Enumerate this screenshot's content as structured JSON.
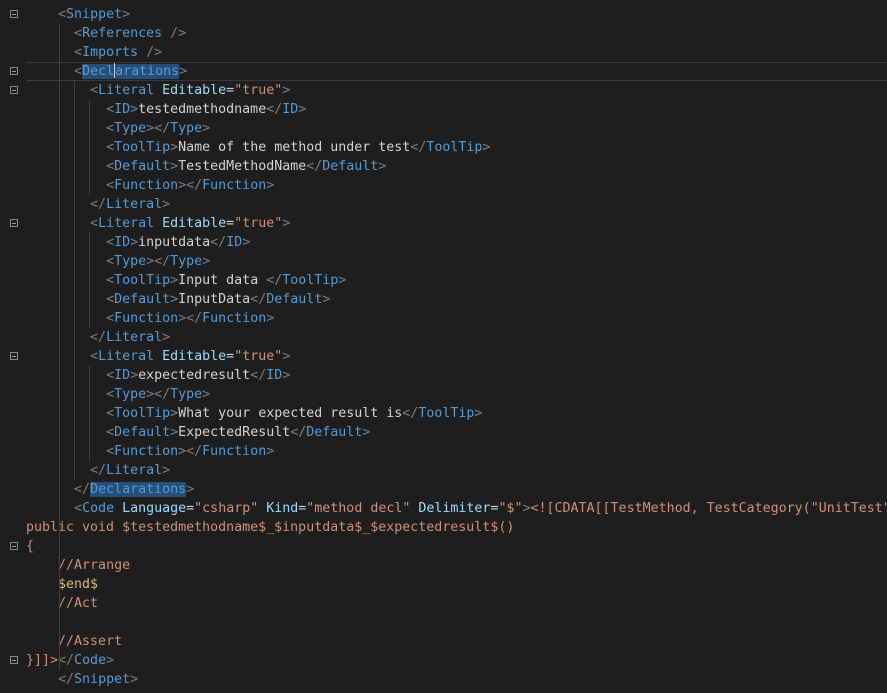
{
  "editor": {
    "lines": [
      {
        "fold": true,
        "indent": 4,
        "tokens": [
          [
            "punct",
            "<"
          ],
          [
            "tag",
            "Snippet"
          ],
          [
            "punct",
            ">"
          ]
        ]
      },
      {
        "fold": false,
        "indent": 6,
        "tokens": [
          [
            "punct",
            "<"
          ],
          [
            "tag",
            "References"
          ],
          [
            "punct",
            " />"
          ]
        ]
      },
      {
        "fold": false,
        "indent": 6,
        "tokens": [
          [
            "punct",
            "<"
          ],
          [
            "tag",
            "Imports"
          ],
          [
            "punct",
            " />"
          ]
        ]
      },
      {
        "fold": true,
        "indent": 6,
        "current": true,
        "tokens": [
          [
            "punct",
            "<"
          ],
          [
            "tag-hl",
            "Decl"
          ],
          [
            "caret",
            ""
          ],
          [
            "tag-hl",
            "arations"
          ],
          [
            "punct",
            ">"
          ]
        ]
      },
      {
        "fold": true,
        "indent": 8,
        "tokens": [
          [
            "punct",
            "<"
          ],
          [
            "tag",
            "Literal"
          ],
          [
            "text",
            " "
          ],
          [
            "attr",
            "Editable"
          ],
          [
            "text",
            "="
          ],
          [
            "str",
            "\"true\""
          ],
          [
            "punct",
            ">"
          ]
        ]
      },
      {
        "fold": false,
        "indent": 10,
        "tokens": [
          [
            "punct",
            "<"
          ],
          [
            "tag",
            "ID"
          ],
          [
            "punct",
            ">"
          ],
          [
            "text",
            "testedmethodname"
          ],
          [
            "punct",
            "</"
          ],
          [
            "tag",
            "ID"
          ],
          [
            "punct",
            ">"
          ]
        ]
      },
      {
        "fold": false,
        "indent": 10,
        "tokens": [
          [
            "punct",
            "<"
          ],
          [
            "tag",
            "Type"
          ],
          [
            "punct",
            "></"
          ],
          [
            "tag",
            "Type"
          ],
          [
            "punct",
            ">"
          ]
        ]
      },
      {
        "fold": false,
        "indent": 10,
        "tokens": [
          [
            "punct",
            "<"
          ],
          [
            "tag",
            "ToolTip"
          ],
          [
            "punct",
            ">"
          ],
          [
            "text",
            "Name of the method under test"
          ],
          [
            "punct",
            "</"
          ],
          [
            "tag",
            "ToolTip"
          ],
          [
            "punct",
            ">"
          ]
        ]
      },
      {
        "fold": false,
        "indent": 10,
        "tokens": [
          [
            "punct",
            "<"
          ],
          [
            "tag",
            "Default"
          ],
          [
            "punct",
            ">"
          ],
          [
            "text",
            "TestedMethodName"
          ],
          [
            "punct",
            "</"
          ],
          [
            "tag",
            "Default"
          ],
          [
            "punct",
            ">"
          ]
        ]
      },
      {
        "fold": false,
        "indent": 10,
        "tokens": [
          [
            "punct",
            "<"
          ],
          [
            "tag",
            "Function"
          ],
          [
            "punct",
            "></"
          ],
          [
            "tag",
            "Function"
          ],
          [
            "punct",
            ">"
          ]
        ]
      },
      {
        "fold": false,
        "indent": 8,
        "tokens": [
          [
            "punct",
            "</"
          ],
          [
            "tag",
            "Literal"
          ],
          [
            "punct",
            ">"
          ]
        ]
      },
      {
        "fold": true,
        "indent": 8,
        "tokens": [
          [
            "punct",
            "<"
          ],
          [
            "tag",
            "Literal"
          ],
          [
            "text",
            " "
          ],
          [
            "attr",
            "Editable"
          ],
          [
            "text",
            "="
          ],
          [
            "str",
            "\"true\""
          ],
          [
            "punct",
            ">"
          ]
        ]
      },
      {
        "fold": false,
        "indent": 10,
        "tokens": [
          [
            "punct",
            "<"
          ],
          [
            "tag",
            "ID"
          ],
          [
            "punct",
            ">"
          ],
          [
            "text",
            "inputdata"
          ],
          [
            "punct",
            "</"
          ],
          [
            "tag",
            "ID"
          ],
          [
            "punct",
            ">"
          ]
        ]
      },
      {
        "fold": false,
        "indent": 10,
        "tokens": [
          [
            "punct",
            "<"
          ],
          [
            "tag",
            "Type"
          ],
          [
            "punct",
            "></"
          ],
          [
            "tag",
            "Type"
          ],
          [
            "punct",
            ">"
          ]
        ]
      },
      {
        "fold": false,
        "indent": 10,
        "tokens": [
          [
            "punct",
            "<"
          ],
          [
            "tag",
            "ToolTip"
          ],
          [
            "punct",
            ">"
          ],
          [
            "text",
            "Input data "
          ],
          [
            "punct",
            "</"
          ],
          [
            "tag",
            "ToolTip"
          ],
          [
            "punct",
            ">"
          ]
        ]
      },
      {
        "fold": false,
        "indent": 10,
        "tokens": [
          [
            "punct",
            "<"
          ],
          [
            "tag",
            "Default"
          ],
          [
            "punct",
            ">"
          ],
          [
            "text",
            "InputData"
          ],
          [
            "punct",
            "</"
          ],
          [
            "tag",
            "Default"
          ],
          [
            "punct",
            ">"
          ]
        ]
      },
      {
        "fold": false,
        "indent": 10,
        "tokens": [
          [
            "punct",
            "<"
          ],
          [
            "tag",
            "Function"
          ],
          [
            "punct",
            "></"
          ],
          [
            "tag",
            "Function"
          ],
          [
            "punct",
            ">"
          ]
        ]
      },
      {
        "fold": false,
        "indent": 8,
        "tokens": [
          [
            "punct",
            "</"
          ],
          [
            "tag",
            "Literal"
          ],
          [
            "punct",
            ">"
          ]
        ]
      },
      {
        "fold": true,
        "indent": 8,
        "tokens": [
          [
            "punct",
            "<"
          ],
          [
            "tag",
            "Literal"
          ],
          [
            "text",
            " "
          ],
          [
            "attr",
            "Editable"
          ],
          [
            "text",
            "="
          ],
          [
            "str",
            "\"true\""
          ],
          [
            "punct",
            ">"
          ]
        ]
      },
      {
        "fold": false,
        "indent": 10,
        "tokens": [
          [
            "punct",
            "<"
          ],
          [
            "tag",
            "ID"
          ],
          [
            "punct",
            ">"
          ],
          [
            "text",
            "expectedresult"
          ],
          [
            "punct",
            "</"
          ],
          [
            "tag",
            "ID"
          ],
          [
            "punct",
            ">"
          ]
        ]
      },
      {
        "fold": false,
        "indent": 10,
        "tokens": [
          [
            "punct",
            "<"
          ],
          [
            "tag",
            "Type"
          ],
          [
            "punct",
            "></"
          ],
          [
            "tag",
            "Type"
          ],
          [
            "punct",
            ">"
          ]
        ]
      },
      {
        "fold": false,
        "indent": 10,
        "tokens": [
          [
            "punct",
            "<"
          ],
          [
            "tag",
            "ToolTip"
          ],
          [
            "punct",
            ">"
          ],
          [
            "text",
            "What your expected result is"
          ],
          [
            "punct",
            "</"
          ],
          [
            "tag",
            "ToolTip"
          ],
          [
            "punct",
            ">"
          ]
        ]
      },
      {
        "fold": false,
        "indent": 10,
        "tokens": [
          [
            "punct",
            "<"
          ],
          [
            "tag",
            "Default"
          ],
          [
            "punct",
            ">"
          ],
          [
            "text",
            "ExpectedResult"
          ],
          [
            "punct",
            "</"
          ],
          [
            "tag",
            "Default"
          ],
          [
            "punct",
            ">"
          ]
        ]
      },
      {
        "fold": false,
        "indent": 10,
        "tokens": [
          [
            "punct",
            "<"
          ],
          [
            "tag",
            "Function"
          ],
          [
            "punct",
            "></"
          ],
          [
            "tag",
            "Function"
          ],
          [
            "punct",
            ">"
          ]
        ]
      },
      {
        "fold": false,
        "indent": 8,
        "tokens": [
          [
            "punct",
            "</"
          ],
          [
            "tag",
            "Literal"
          ],
          [
            "punct",
            ">"
          ]
        ]
      },
      {
        "fold": false,
        "indent": 6,
        "tokens": [
          [
            "punct",
            "</"
          ],
          [
            "tag-hl",
            "Declarations"
          ],
          [
            "punct",
            ">"
          ]
        ]
      },
      {
        "fold": false,
        "indent": 6,
        "tokens": [
          [
            "punct",
            "<"
          ],
          [
            "tag",
            "Code"
          ],
          [
            "text",
            " "
          ],
          [
            "attr",
            "Language"
          ],
          [
            "text",
            "="
          ],
          [
            "str",
            "\"csharp\""
          ],
          [
            "text",
            " "
          ],
          [
            "attr",
            "Kind"
          ],
          [
            "text",
            "="
          ],
          [
            "str",
            "\"method decl\""
          ],
          [
            "text",
            " "
          ],
          [
            "attr",
            "Delimiter"
          ],
          [
            "text",
            "="
          ],
          [
            "str",
            "\"$\""
          ],
          [
            "punct",
            ">"
          ],
          [
            "cdata",
            "<![CDATA[[TestMethod, TestCategory(\"UnitTest\")]"
          ]
        ]
      },
      {
        "fold": false,
        "indent": 0,
        "tokens": [
          [
            "cdata",
            "public void $testedmethodname$_$inputdata$_$expectedresult$()"
          ]
        ]
      },
      {
        "fold": true,
        "indent": 0,
        "tokens": [
          [
            "cdata",
            "{"
          ]
        ]
      },
      {
        "fold": false,
        "indent": 4,
        "tokens": [
          [
            "cdata",
            "//Arrange"
          ]
        ]
      },
      {
        "fold": false,
        "indent": 4,
        "tokens": [
          [
            "comment",
            "$end$"
          ]
        ]
      },
      {
        "fold": false,
        "indent": 4,
        "tokens": [
          [
            "cdata",
            "//Act"
          ]
        ]
      },
      {
        "fold": false,
        "indent": 0,
        "tokens": []
      },
      {
        "fold": false,
        "indent": 4,
        "tokens": [
          [
            "cdata",
            "//Assert"
          ]
        ]
      },
      {
        "fold": true,
        "indent": 0,
        "tokens": [
          [
            "cdata",
            "}]]>"
          ],
          [
            "punct",
            "</"
          ],
          [
            "tag",
            "Code"
          ],
          [
            "punct",
            ">"
          ]
        ]
      },
      {
        "fold": false,
        "indent": 4,
        "tokens": [
          [
            "punct",
            "</"
          ],
          [
            "tag",
            "Snippet"
          ],
          [
            "punct",
            ">"
          ]
        ]
      }
    ]
  },
  "colors": {
    "background": "#1e1e1e",
    "punct": "#808080",
    "tag": "#569cd6",
    "attr": "#9cdcfe",
    "string": "#ce9178",
    "text": "#d4d4d4",
    "selection_highlight": "#264f78"
  },
  "icons": {
    "fold": "collapse-minus-icon"
  }
}
